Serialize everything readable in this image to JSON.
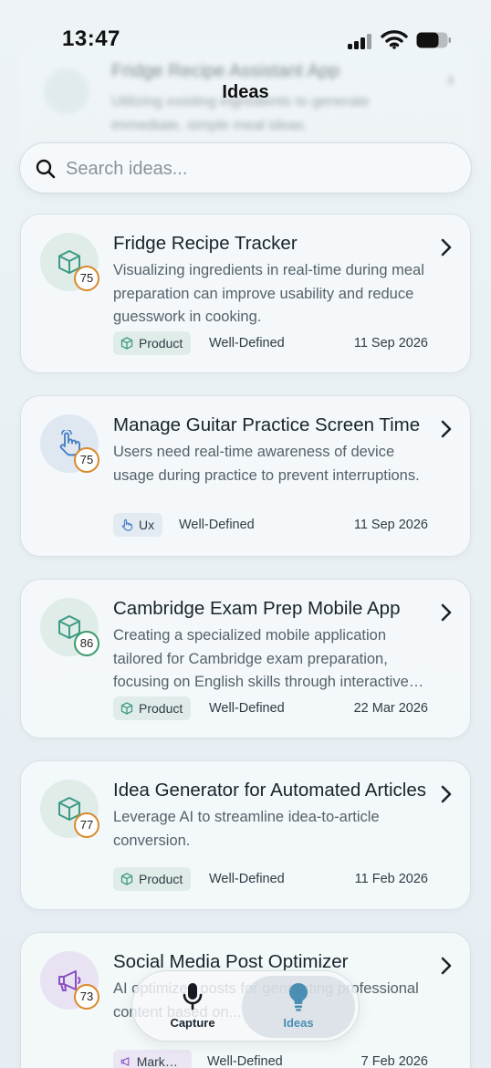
{
  "status_bar": {
    "time": "13:47"
  },
  "ghost_card": {
    "title": "Fridge Recipe Assistant App",
    "description": "Utilizing existing ingredients to generate immediate, simple meal ideas."
  },
  "header": {
    "title": "Ideas"
  },
  "search": {
    "placeholder": "Search ideas..."
  },
  "ideas": [
    {
      "title": "Fridge Recipe Tracker",
      "description": "Visualizing ingredients in real-time during meal preparation can improve usability and reduce guesswork in cooking.",
      "score": "75",
      "category": "Product",
      "category_icon": "cube-icon",
      "status": "Well-Defined",
      "date": "11 Sep 2026"
    },
    {
      "title": "Manage Guitar Practice Screen Time",
      "description": "Users need real-time awareness of device usage during practice to prevent interruptions.",
      "score": "75",
      "category": "Ux",
      "category_icon": "hand-pointer-icon",
      "status": "Well-Defined",
      "date": "11 Sep 2026"
    },
    {
      "title": "Cambridge Exam Prep Mobile App",
      "description": "Creating a specialized mobile application tailored for Cambridge exam preparation, focusing on English skills through interactive content.",
      "score": "86",
      "category": "Product",
      "category_icon": "cube-icon",
      "status": "Well-Defined",
      "date": "22 Mar 2026"
    },
    {
      "title": "Idea Generator for Automated Articles",
      "description": "Leverage AI to streamline idea-to-article conversion.",
      "score": "77",
      "category": "Product",
      "category_icon": "cube-icon",
      "status": "Well-Defined",
      "date": "11 Feb 2026"
    },
    {
      "title": "Social Media Post Optimizer",
      "description": "AI optimized posts for generating professional content based on...",
      "score": "73",
      "category": "Marketing",
      "category_icon": "megaphone-icon",
      "status": "Well-Defined",
      "date": "7 Feb 2026"
    }
  ],
  "bottom_nav": {
    "items": [
      {
        "label": "Capture",
        "icon": "microphone-icon"
      },
      {
        "label": "Ideas",
        "icon": "lightbulb-icon",
        "active": true
      }
    ]
  },
  "colors": {
    "accent": "#4a8fb3",
    "score_orange": "#d98a2b",
    "score_green": "#3d9a6a",
    "product_icon": "#3d9a86",
    "ux_icon": "#4a80c4",
    "marketing_icon": "#8a4fc4"
  }
}
